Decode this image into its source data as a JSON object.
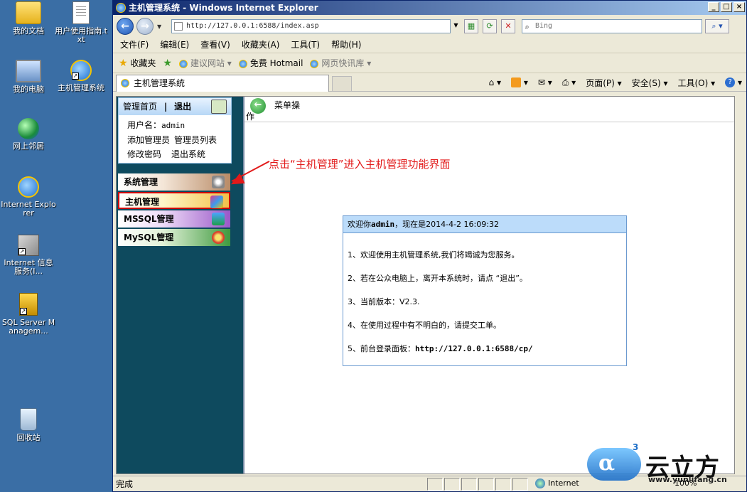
{
  "desktop": {
    "icons": [
      {
        "label": "我的文档",
        "icon": "folder-icon"
      },
      {
        "label": "用户使用指南.txt",
        "icon": "text-file-icon"
      },
      {
        "label": "我的电脑",
        "icon": "computer-icon"
      },
      {
        "label": "主机管理系统",
        "icon": "ie-shortcut-icon"
      },
      {
        "label": "网上邻居",
        "icon": "network-icon"
      },
      {
        "label": "Internet Explorer",
        "icon": "ie-icon"
      },
      {
        "label": "Internet 信息服务(I...",
        "icon": "iis-shortcut-icon"
      },
      {
        "label": "SQL Server Managem...",
        "icon": "sql-server-shortcut-icon"
      },
      {
        "label": "回收站",
        "icon": "recycle-bin-icon"
      }
    ]
  },
  "window": {
    "title": "主机管理系统 - Windows Internet Explorer",
    "url": "http://127.0.0.1:6588/index.asp",
    "search_placeholder": "Bing",
    "controls": {
      "minimize": "_",
      "maximize": "□",
      "close": "×"
    }
  },
  "menu": [
    "文件(F)",
    "编辑(E)",
    "查看(V)",
    "收藏夹(A)",
    "工具(T)",
    "帮助(H)"
  ],
  "favorites": {
    "label": "收藏夹",
    "items": [
      "建议网站 ▾",
      "免费 Hotmail",
      "网页快讯库 ▾"
    ]
  },
  "tab": {
    "title": "主机管理系统"
  },
  "command_bar": [
    "页面(P) ▾",
    "安全(S) ▾",
    "工具(O) ▾"
  ],
  "sidebar": {
    "header_home": "管理首页",
    "header_separator": "|",
    "header_logout": "退出",
    "username_label": "用户名：",
    "username": "admin",
    "links": [
      "添加管理员",
      "管理员列表",
      "修改密码",
      "退出系统"
    ],
    "menu": [
      "系统管理",
      "主机管理",
      "MSSQL管理",
      "MySQL管理"
    ]
  },
  "main": {
    "op_title": "菜单操作",
    "annotation": "点击“主机管理”进入主机管理功能界面",
    "welcome": {
      "head_prefix": "欢迎你",
      "head_user": "admin",
      "head_suffix": "，现在是2014-4-2 16:09:32",
      "items": [
        "1、欢迎使用主机管理系统,我们将竭诚为您服务。",
        "2、若在公众电脑上，离开本系统时，请点 “退出”。",
        "3、当前版本：V2.3.",
        "4、在使用过程中有不明白的，请提交工单。"
      ],
      "item5_prefix": "5、前台登录面板：",
      "item5_url": "http://127.0.0.1:6588/cp/"
    }
  },
  "status": {
    "text": "完成",
    "zone": "Internet",
    "zoom": "100%"
  },
  "watermark": {
    "name": "云立方",
    "url": "www.yunlifang.cn",
    "logo_letter": "α",
    "logo_sup": "3"
  }
}
